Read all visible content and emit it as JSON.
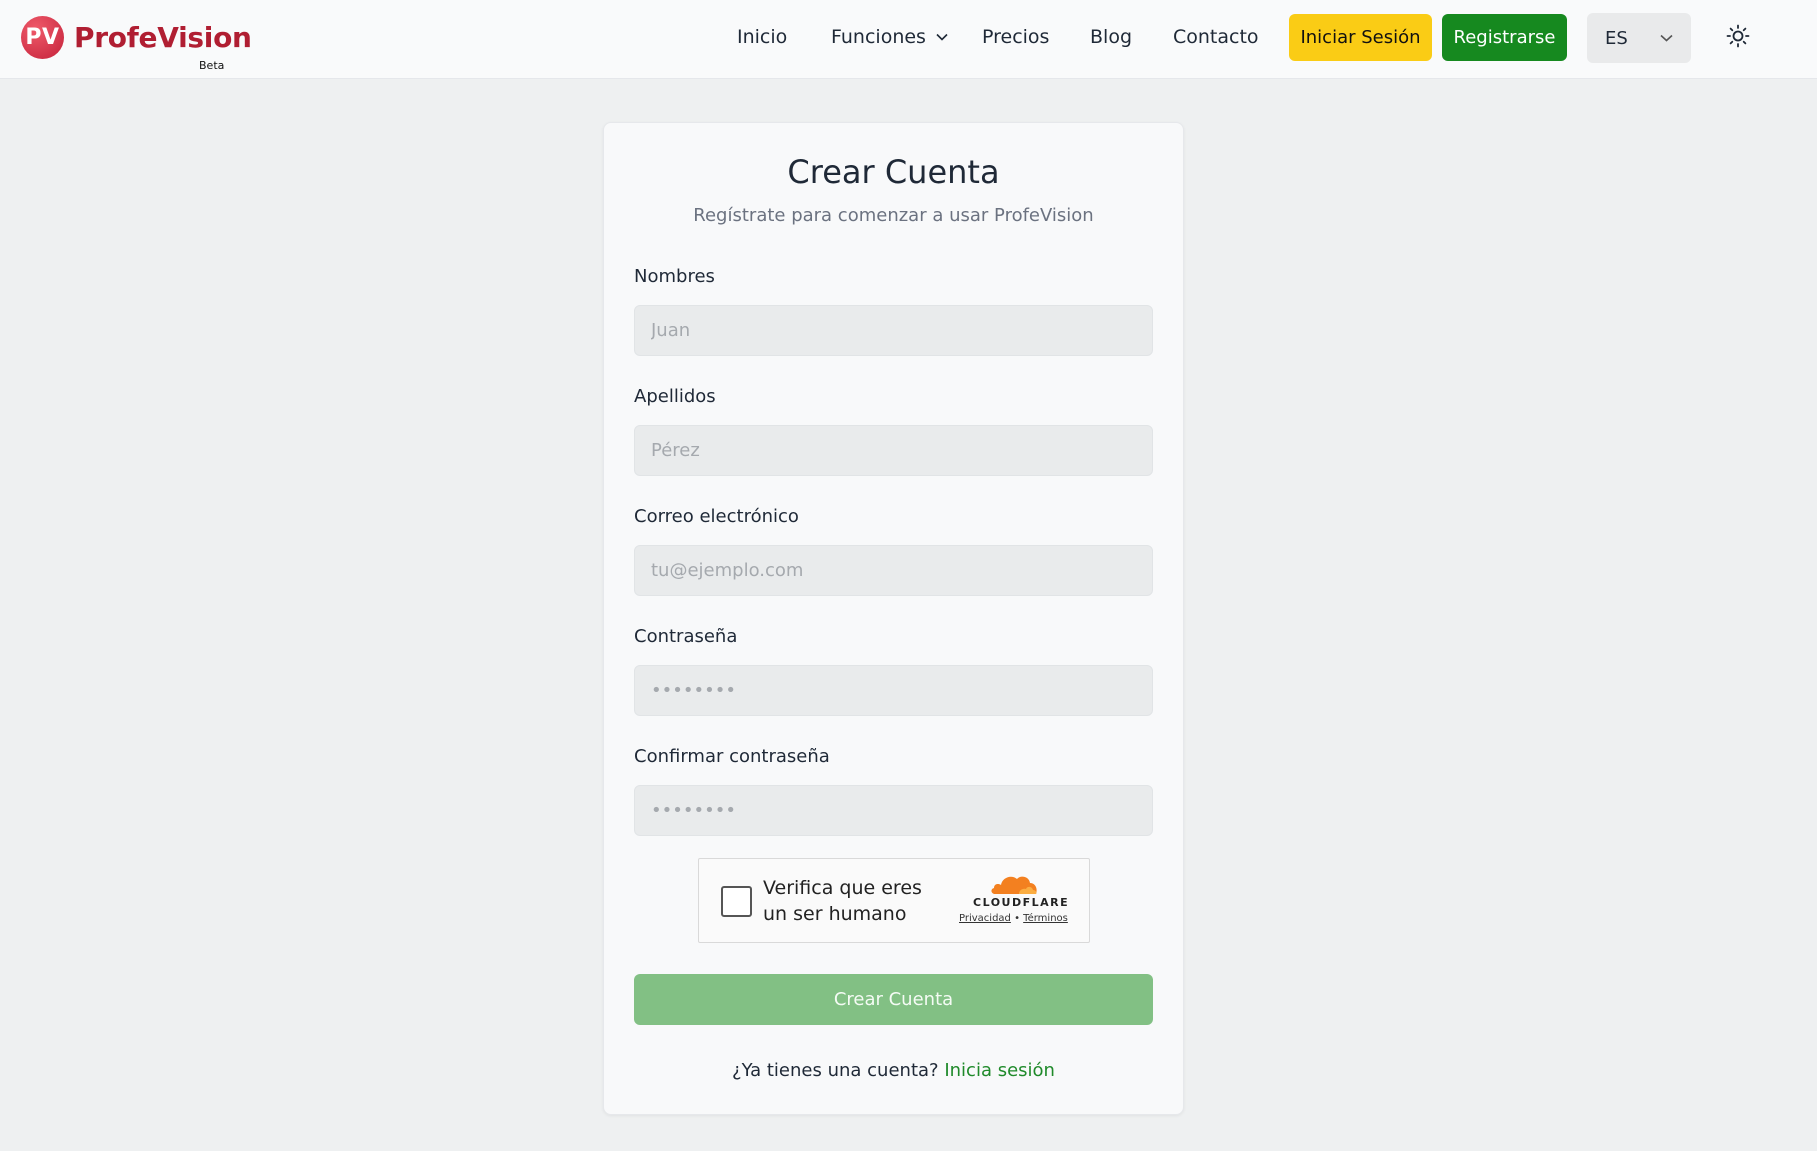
{
  "header": {
    "logo_initials": "PV",
    "logo_name": "ProfeVision",
    "logo_badge": "Beta",
    "nav": {
      "home": "Inicio",
      "features": "Funciones",
      "pricing": "Precios",
      "blog": "Blog",
      "contact": "Contacto"
    },
    "login_label": "Iniciar Sesión",
    "register_label": "Registrarse",
    "language": "ES",
    "icons": {
      "features_chevron": "chevron-down-icon",
      "language_chevron": "chevron-down-icon",
      "theme": "sun-icon"
    }
  },
  "form": {
    "title": "Crear Cuenta",
    "subtitle": "Regístrate para comenzar a usar ProfeVision",
    "fields": {
      "first_name": {
        "label": "Nombres",
        "placeholder": "Juan",
        "value": ""
      },
      "last_name": {
        "label": "Apellidos",
        "placeholder": "Pérez",
        "value": ""
      },
      "email": {
        "label": "Correo electrónico",
        "placeholder": "tu@ejemplo.com",
        "value": ""
      },
      "password": {
        "label": "Contraseña",
        "placeholder": "••••••••",
        "value": ""
      },
      "confirm_password": {
        "label": "Confirmar contraseña",
        "placeholder": "••••••••",
        "value": ""
      }
    },
    "captcha": {
      "text": "Verifica que eres un ser humano",
      "brand": "CLOUDFLARE",
      "privacy": "Privacidad",
      "separator": "•",
      "terms": "Términos",
      "checked": false
    },
    "submit_label": "Crear Cuenta",
    "signin_prompt": "¿Ya tienes una cuenta?",
    "signin_link": "Inicia sesión"
  },
  "colors": {
    "brand": "#b01e32",
    "login_button": "#facc15",
    "register_button": "#16891f",
    "submit_button_disabled": "#82c084",
    "link": "#1f8a2a"
  }
}
